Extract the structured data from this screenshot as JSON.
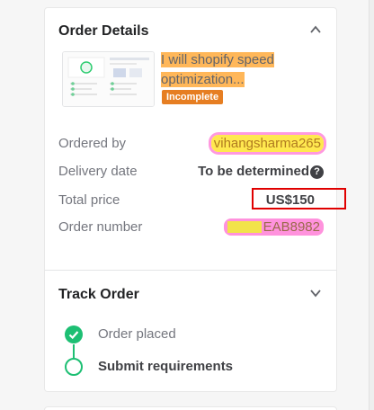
{
  "order_details": {
    "title": "Order Details",
    "gig_title": "I will shopify speed optimization...",
    "status": "Incomplete",
    "rows": [
      {
        "label": "Ordered by",
        "value": "vihangsharma265"
      },
      {
        "label": "Delivery date",
        "value": "To be determined"
      },
      {
        "label": "Total price",
        "value": "US$150"
      },
      {
        "label": "Order number",
        "value": "EAB8982"
      }
    ],
    "help_icon_glyph": "?"
  },
  "track_order": {
    "title": "Track Order",
    "steps": [
      {
        "label": "Order placed",
        "state": "done"
      },
      {
        "label": "Submit requirements",
        "state": "pending"
      }
    ]
  },
  "colors": {
    "accent_green": "#1dbf73",
    "badge_orange": "#e67e22",
    "highlight_box_red": "#e00000"
  },
  "icons": {
    "collapse": "chevron-up-icon",
    "expand": "chevron-down-icon",
    "step_done": "check-circle-icon",
    "step_pending": "empty-circle-icon",
    "help": "question-circle-icon"
  }
}
